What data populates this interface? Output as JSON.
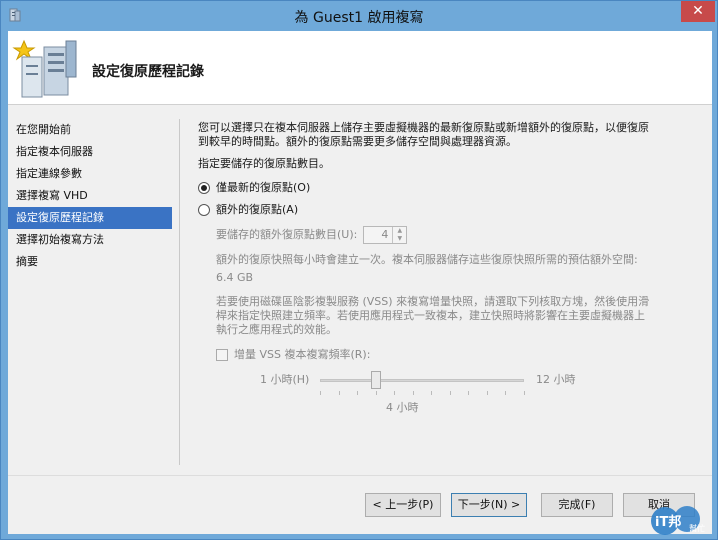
{
  "window": {
    "title": "為 Guest1 啟用複寫",
    "close_label": "✕"
  },
  "header": {
    "title": "設定復原歷程記錄",
    "icon": "server-wizard-icon"
  },
  "nav": {
    "items": [
      {
        "label": "在您開始前",
        "active": false
      },
      {
        "label": "指定複本伺服器",
        "active": false
      },
      {
        "label": "指定連線參數",
        "active": false
      },
      {
        "label": "選擇複寫 VHD",
        "active": false
      },
      {
        "label": "設定復原歷程記錄",
        "active": true
      },
      {
        "label": "選擇初始複寫方法",
        "active": false
      },
      {
        "label": "摘要",
        "active": false
      }
    ]
  },
  "content": {
    "description_1": "您可以選擇只在複本伺服器上儲存主要虛擬機器的最新復原點或新增額外的復原點，以便復原",
    "description_2": "到較早的時間點。額外的復原點需要更多儲存空間與處理器資源。",
    "prompt": "指定要儲存的復原點數目。",
    "radio_latest_label": "僅最新的復原點(O)",
    "radio_additional_label": "額外的復原點(A)",
    "extra_points_label": "要儲存的額外復原點數目(U):",
    "extra_points_value": "4",
    "snapshot_note": "額外的復原快照每小時會建立一次。複本伺服器儲存這些復原快照所需的預估額外空間:",
    "snapshot_size": "6.4 GB",
    "vss_note_1": "若要使用磁碟區陰影複製服務 (VSS) 來複寫增量快照，請選取下列核取方塊，然後使用滑",
    "vss_note_2": "桿來指定快照建立頻率。若使用應用程式一致複本，建立快照時將影響在主要虛擬機器上",
    "vss_note_3": "執行之應用程式的效能。",
    "vss_checkbox_label": "增量 VSS 複本複寫頻率(R):",
    "slider_min_label": "1 小時(H)",
    "slider_max_label": "12 小時",
    "slider_value_label": "4 小時",
    "slider_value": 4,
    "slider_min": 1,
    "slider_max": 12
  },
  "footer": {
    "back_label": "< 上一步(P)",
    "next_label": "下一步(N) >",
    "finish_label": "完成(F)",
    "cancel_label": "取消"
  },
  "watermark": {
    "text": "iT邦幫忙"
  },
  "colors": {
    "accent": "#3a73c4",
    "frame": "#6fa9d9",
    "close": "#c74a4a"
  }
}
